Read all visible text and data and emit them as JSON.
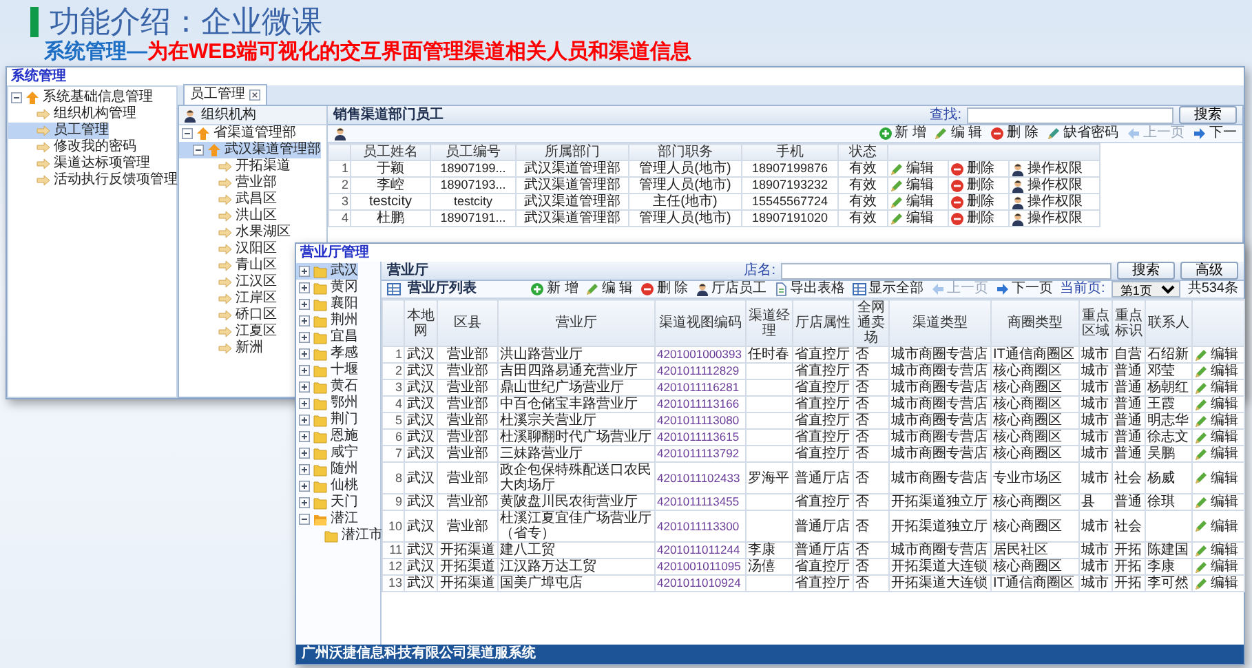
{
  "slide": {
    "title": "功能介绍：企业微课",
    "subtitle_lead": "系统管理—",
    "subtitle_text": "为在WEB端可视化的交互界面管理渠道相关人员和渠道信息"
  },
  "back_window": {
    "title": "系统管理",
    "menu": [
      {
        "label": "系统基础信息管理",
        "expanded": true,
        "selected": false,
        "children": [
          {
            "label": "组织机构管理",
            "selected": false
          },
          {
            "label": "员工管理",
            "selected": true
          },
          {
            "label": "修改我的密码",
            "selected": false
          },
          {
            "label": "渠道达标项管理",
            "selected": false
          },
          {
            "label": "活动执行反馈项管理",
            "selected": false
          }
        ]
      }
    ],
    "tab": {
      "label": "员工管理",
      "selected": true
    },
    "org_title": "组织机构",
    "org_tree": [
      {
        "label": "省渠道管理部",
        "expanded": true,
        "selected": false,
        "children": [
          {
            "label": "武汉渠道管理部",
            "expanded": true,
            "selected": true,
            "children": [
              {
                "label": "开拓渠道",
                "selected": false
              },
              {
                "label": "营业部",
                "selected": false
              },
              {
                "label": "武昌区",
                "selected": false
              },
              {
                "label": "洪山区",
                "selected": false
              },
              {
                "label": "水果湖区",
                "selected": false
              },
              {
                "label": "汉阳区",
                "selected": false
              },
              {
                "label": "青山区",
                "selected": false
              },
              {
                "label": "江汉区",
                "selected": false
              },
              {
                "label": "江岸区",
                "selected": false
              },
              {
                "label": "硚口区",
                "selected": false
              },
              {
                "label": "江夏区",
                "selected": false
              },
              {
                "label": "新洲",
                "selected": false
              }
            ]
          }
        ]
      }
    ],
    "panel_title": "销售渠道部门员工",
    "search_label": "查找:",
    "search_button": "搜索",
    "toolbar": [
      {
        "kind": "add",
        "label": "新 增",
        "disabled": false
      },
      {
        "kind": "edit",
        "label": "编 辑",
        "disabled": false
      },
      {
        "kind": "delete",
        "label": "删 除",
        "disabled": false
      },
      {
        "kind": "reset",
        "label": "缺省密码",
        "disabled": false
      },
      {
        "kind": "prev",
        "label": "上一页",
        "disabled": true
      },
      {
        "kind": "next",
        "label": "下一",
        "disabled": false
      }
    ],
    "columns": [
      "员工姓名",
      "员工编号",
      "所属部门",
      "部门职务",
      "手机",
      "状态"
    ],
    "rows": [
      {
        "index": "1",
        "cells": [
          "于颖",
          "18907199...",
          "武汉渠道管理部",
          "管理人员(地市)",
          "18907199876",
          "有效"
        ],
        "actions": [
          {
            "kind": "edit",
            "label": "编辑"
          },
          {
            "kind": "delete",
            "label": "删除"
          },
          {
            "kind": "user",
            "label": "操作权限"
          }
        ]
      },
      {
        "index": "2",
        "cells": [
          "李崆",
          "18907193...",
          "武汉渠道管理部",
          "管理人员(地市)",
          "18907193232",
          "有效"
        ],
        "actions": [
          {
            "kind": "edit",
            "label": "编辑"
          },
          {
            "kind": "delete",
            "label": "删除"
          },
          {
            "kind": "user",
            "label": "操作权限"
          }
        ]
      },
      {
        "index": "3",
        "cells": [
          "testcity",
          "testcity",
          "武汉渠道管理部",
          "主任(地市)",
          "15545567724",
          "有效"
        ],
        "actions": [
          {
            "kind": "edit",
            "label": "编辑"
          },
          {
            "kind": "delete",
            "label": "删除"
          },
          {
            "kind": "user",
            "label": "操作权限"
          }
        ]
      },
      {
        "index": "4",
        "cells": [
          "杜鹏",
          "18907191...",
          "武汉渠道管理部",
          "管理人员(地市)",
          "18907191020",
          "有效"
        ],
        "actions": [
          {
            "kind": "edit",
            "label": "编辑"
          },
          {
            "kind": "delete",
            "label": "删除"
          },
          {
            "kind": "user",
            "label": "操作权限"
          }
        ]
      }
    ]
  },
  "front_window": {
    "title": "营业厅管理",
    "cities": [
      {
        "label": "武汉",
        "expanded": false,
        "selected": true
      },
      {
        "label": "黄冈",
        "expanded": false,
        "selected": false
      },
      {
        "label": "襄阳",
        "expanded": false,
        "selected": false
      },
      {
        "label": "荆州",
        "expanded": false,
        "selected": false
      },
      {
        "label": "宜昌",
        "expanded": false,
        "selected": false
      },
      {
        "label": "孝感",
        "expanded": false,
        "selected": false
      },
      {
        "label": "十堰",
        "expanded": false,
        "selected": false
      },
      {
        "label": "黄石",
        "expanded": false,
        "selected": false
      },
      {
        "label": "鄂州",
        "expanded": false,
        "selected": false
      },
      {
        "label": "荆门",
        "expanded": false,
        "selected": false
      },
      {
        "label": "恩施",
        "expanded": false,
        "selected": false
      },
      {
        "label": "咸宁",
        "expanded": false,
        "selected": false
      },
      {
        "label": "随州",
        "expanded": false,
        "selected": false
      },
      {
        "label": "仙桃",
        "expanded": false,
        "selected": false
      },
      {
        "label": "天门",
        "expanded": false,
        "selected": false
      },
      {
        "label": "潜江",
        "expanded": true,
        "selected": false,
        "children": [
          {
            "label": "潜江市",
            "selected": false
          }
        ]
      }
    ],
    "panel_title": "营业厅",
    "search_label": "店名:",
    "search_buttons": [
      "搜索",
      "高级"
    ],
    "list_title": "营业厅列表",
    "toolbar": [
      {
        "kind": "add",
        "label": "新 增",
        "disabled": false
      },
      {
        "kind": "edit",
        "label": "编 辑",
        "disabled": false
      },
      {
        "kind": "delete",
        "label": "删 除",
        "disabled": false
      },
      {
        "kind": "user",
        "label": "厅店员工",
        "disabled": false
      },
      {
        "kind": "export",
        "label": "导出表格",
        "disabled": false
      },
      {
        "kind": "grid",
        "label": "显示全部",
        "disabled": false
      },
      {
        "kind": "prev",
        "label": "上一页",
        "disabled": true
      },
      {
        "kind": "next",
        "label": "下一页",
        "disabled": false
      }
    ],
    "page_label": "当前页:",
    "page_value": "第1页",
    "total": "共534条",
    "columns": [
      "本地网",
      "区县",
      "营业厅",
      "渠道视图编码",
      "渠道经理",
      "厅店属性",
      "全网通卖场",
      "渠道类型",
      "商圈类型",
      "重点区域",
      "重点标识",
      "联系人"
    ],
    "rows": [
      {
        "index": "1",
        "cells": [
          "武汉",
          "营业部",
          "洪山路营业厅",
          "4201001000393",
          "任时春",
          "省直控厅",
          "否",
          "城市商圈专营店",
          "IT通信商圈区",
          "城市",
          "自营",
          "石绍新"
        ],
        "action": "编辑"
      },
      {
        "index": "2",
        "cells": [
          "武汉",
          "营业部",
          "吉田四路易通充营业厅",
          "4201011112829",
          "",
          "省直控厅",
          "否",
          "城市商圈专营店",
          "核心商圈区",
          "城市",
          "普通",
          "邓莹"
        ],
        "action": "编辑"
      },
      {
        "index": "3",
        "cells": [
          "武汉",
          "营业部",
          "鼎山世纪广场营业厅",
          "4201011116281",
          "",
          "省直控厅",
          "否",
          "城市商圈专营店",
          "核心商圈区",
          "城市",
          "普通",
          "杨朝红"
        ],
        "action": "编辑"
      },
      {
        "index": "4",
        "cells": [
          "武汉",
          "营业部",
          "中百仓储宝丰路营业厅",
          "4201011113166",
          "",
          "省直控厅",
          "否",
          "城市商圈专营店",
          "核心商圈区",
          "城市",
          "普通",
          "王霞"
        ],
        "action": "编辑"
      },
      {
        "index": "5",
        "cells": [
          "武汉",
          "营业部",
          "杜溪宗关营业厅",
          "4201011113080",
          "",
          "省直控厅",
          "否",
          "城市商圈专营店",
          "核心商圈区",
          "城市",
          "普通",
          "明志华"
        ],
        "action": "编辑"
      },
      {
        "index": "6",
        "cells": [
          "武汉",
          "营业部",
          "杜溪聊翻时代广场营业厅",
          "4201011113615",
          "",
          "省直控厅",
          "否",
          "城市商圈专营店",
          "核心商圈区",
          "城市",
          "普通",
          "徐志文"
        ],
        "action": "编辑"
      },
      {
        "index": "7",
        "cells": [
          "武汉",
          "营业部",
          "三妹路营业厅",
          "4201011113792",
          "",
          "省直控厅",
          "否",
          "城市商圈专营店",
          "核心商圈区",
          "城市",
          "普通",
          "吴鹏"
        ],
        "action": "编辑"
      },
      {
        "index": "8",
        "cells": [
          "武汉",
          "营业部",
          "政企包保特殊配送口农民大肉场厅",
          "4201011102433",
          "罗海平",
          "普通厅店",
          "否",
          "城市商圈专营店",
          "专业市场区",
          "城市",
          "社会",
          "杨威"
        ],
        "action": "编辑"
      },
      {
        "index": "9",
        "cells": [
          "武汉",
          "营业部",
          "黄陂盘川民农街营业厅",
          "4201011113455",
          "",
          "省直控厅",
          "否",
          "开拓渠道独立厅",
          "核心商圈区",
          "县",
          "普通",
          "徐琪"
        ],
        "action": "编辑"
      },
      {
        "index": "10",
        "cells": [
          "武汉",
          "营业部",
          "杜溪江夏宜佳广场营业厅（省专）",
          "4201011113300",
          "",
          "普通厅店",
          "否",
          "开拓渠道独立厅",
          "核心商圈区",
          "城市",
          "社会",
          ""
        ],
        "action": "编辑"
      },
      {
        "index": "11",
        "cells": [
          "武汉",
          "开拓渠道",
          "建八工贸",
          "4201011011244",
          "李康",
          "普通厅店",
          "否",
          "城市商圈专营店",
          "居民社区",
          "城市",
          "开拓",
          "陈建国"
        ],
        "action": "编辑"
      },
      {
        "index": "12",
        "cells": [
          "武汉",
          "开拓渠道",
          "江汉路万达工贸",
          "4201001011095",
          "汤僖",
          "省直控厅",
          "否",
          "开拓渠道大连锁",
          "核心商圈区",
          "城市",
          "开拓",
          "李康"
        ],
        "action": "编辑"
      },
      {
        "index": "13",
        "cells": [
          "武汉",
          "开拓渠道",
          "国美广埠屯店",
          "4201011010924",
          "",
          "省直控厅",
          "否",
          "开拓渠道大连锁",
          "IT通信商圈区",
          "城市",
          "开拓",
          "李可然"
        ],
        "action": "编辑"
      }
    ],
    "footer": "广州沃捷信息科技有限公司渠道服系统"
  }
}
